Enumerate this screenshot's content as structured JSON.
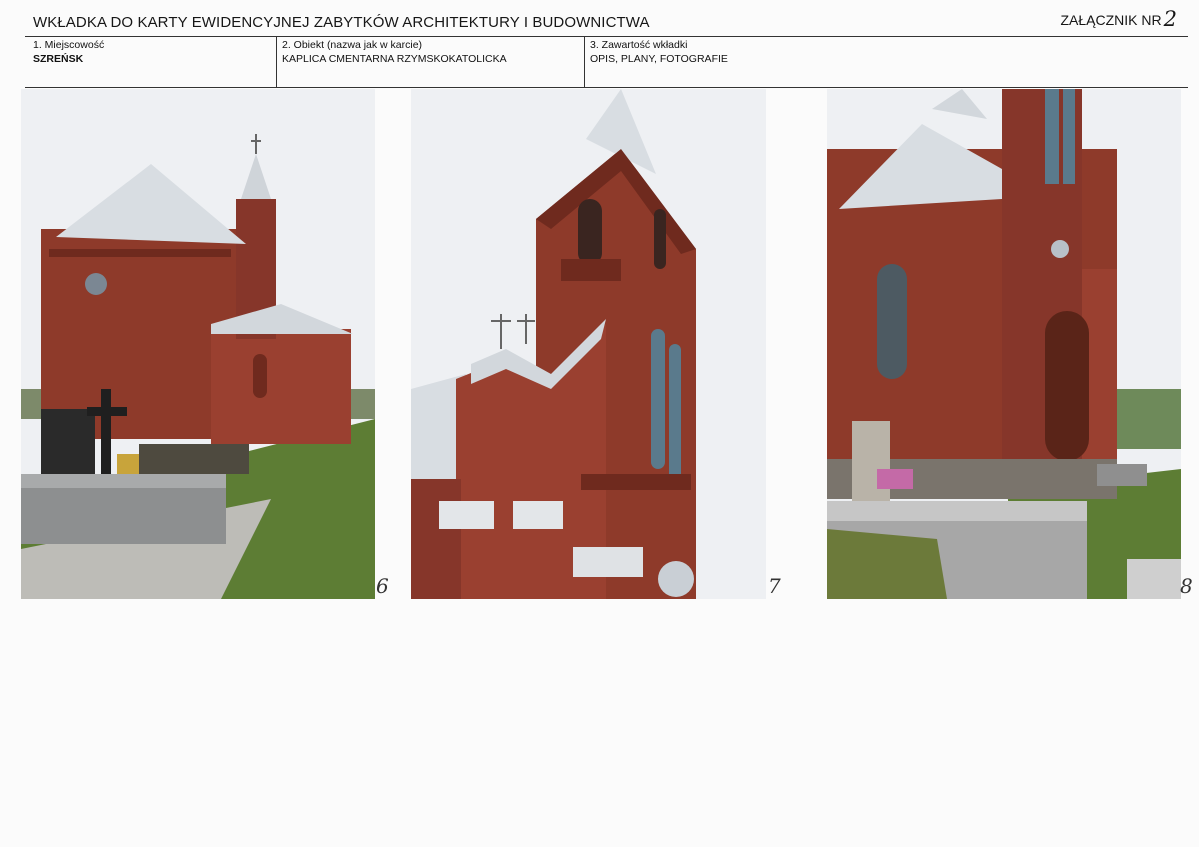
{
  "header": {
    "title": "WKŁADKA DO KARTY EWIDENCYJNEJ ZABYTKÓW ARCHITEKTURY I BUDOWNICTWA",
    "annex_label": "ZAŁĄCZNIK NR",
    "annex_number": "2"
  },
  "fields": [
    {
      "label": "1. Miejscowość",
      "value": "SZREŃSK"
    },
    {
      "label": "2. Obiekt (nazwa jak w karcie)",
      "value": "KAPLICA CMENTARNA RZYMSKOKATOLICKA"
    },
    {
      "label": "3. Zawartość wkładki",
      "value": "OPIS, PLANY, FOTOGRAFIE"
    }
  ],
  "photos": [
    {
      "number": "6"
    },
    {
      "number": "7"
    },
    {
      "number": "8"
    }
  ],
  "colors": {
    "brick": "#8e3a2a",
    "brick_dark": "#6f2a1e",
    "roof": "#d8dde2",
    "grass": "#5d7d34",
    "sky": "#eef0f3"
  }
}
